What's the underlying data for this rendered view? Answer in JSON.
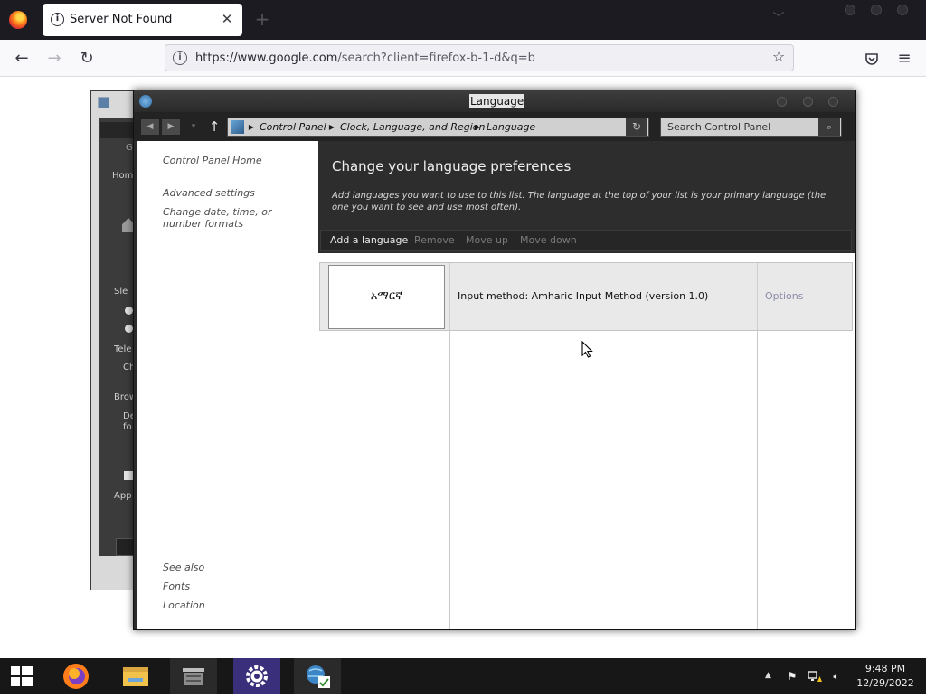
{
  "browser": {
    "tab": {
      "title": "Server Not Found",
      "close": "✕"
    },
    "new_tab": "+",
    "url": {
      "host": "https://www.google.com",
      "path": "/search?client=firefox-b-1-d&q=b"
    }
  },
  "window": {
    "title": "Language",
    "breadcrumb": [
      "Control Panel",
      "Clock, Language, and Region",
      "Language"
    ],
    "search_placeholder": "Search Control Panel"
  },
  "sidebar": {
    "links": [
      "Control Panel Home",
      "Advanced settings",
      "Change date, time, or number formats"
    ],
    "see_also_title": "See also",
    "see_also": [
      "Fonts",
      "Location"
    ]
  },
  "content": {
    "heading": "Change your language preferences",
    "description": "Add languages you want to use to this list. The language at the top of your list is your primary language (the one you want to see and use most often).",
    "toolbar": {
      "add": "Add a language",
      "remove": "Remove",
      "move_up": "Move up",
      "move_down": "Move down"
    },
    "languages": [
      {
        "name": "አማርኛ",
        "input_method": "Input method: Amharic Input Method (version 1.0)",
        "options": "Options"
      }
    ]
  },
  "taskbar": {
    "time": "9:48 PM",
    "date": "12/29/2022"
  },
  "colors": {
    "window_dark": "#2b2b2b",
    "taskbar": "#171717",
    "disabled_text": "#7a7a7a",
    "options_link": "#8b8ca8"
  }
}
